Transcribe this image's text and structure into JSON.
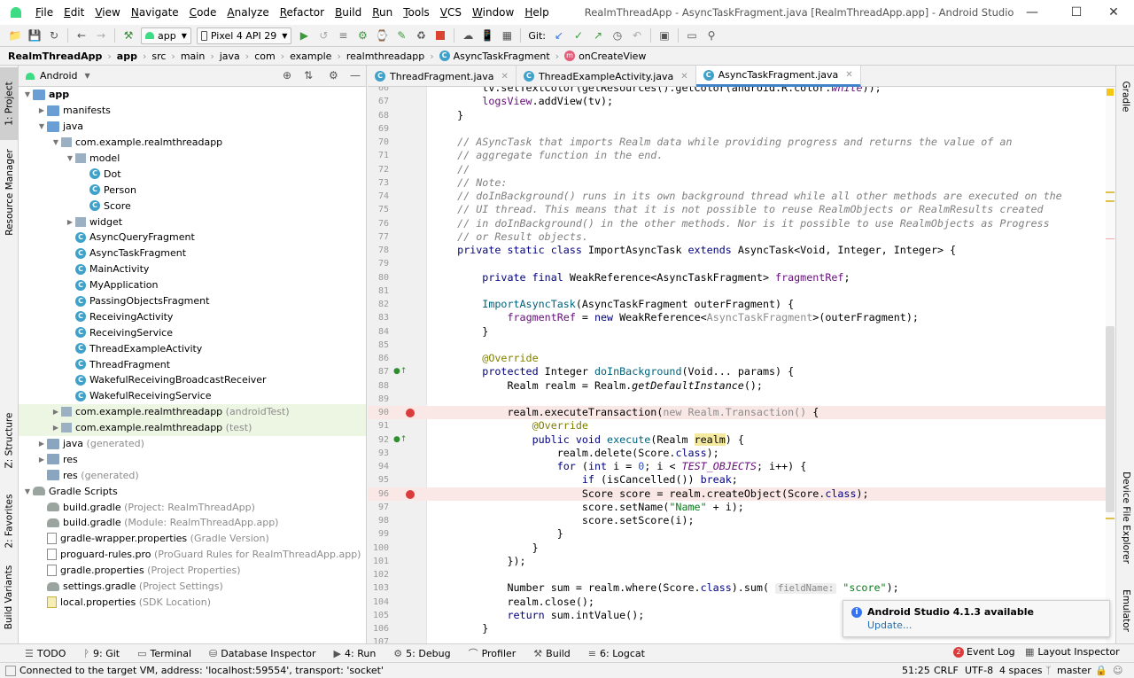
{
  "window": {
    "title": "RealmThreadApp - AsyncTaskFragment.java [RealmThreadApp.app] - Android Studio",
    "minimize_icon": "minimize-icon",
    "maximize_icon": "maximize-icon",
    "close_icon": "close-icon"
  },
  "menu": [
    "File",
    "Edit",
    "View",
    "Navigate",
    "Code",
    "Analyze",
    "Refactor",
    "Build",
    "Run",
    "Tools",
    "VCS",
    "Window",
    "Help"
  ],
  "toolbar": {
    "run_config": "app",
    "device": "Pixel 4 API 29",
    "git_label": "Git:"
  },
  "breadcrumb": [
    "RealmThreadApp",
    "app",
    "src",
    "main",
    "java",
    "com",
    "example",
    "realmthreadapp",
    "AsyncTaskFragment",
    "onCreateView"
  ],
  "project_panel": {
    "view_mode": "Android",
    "tree": [
      {
        "label": "app",
        "extra": "",
        "depth": 0,
        "kind": "folder-blue",
        "open": true,
        "bold": true
      },
      {
        "label": "manifests",
        "extra": "",
        "depth": 1,
        "kind": "folder-blue",
        "open": false
      },
      {
        "label": "java",
        "extra": "",
        "depth": 1,
        "kind": "folder-blue",
        "open": true
      },
      {
        "label": "com.example.realmthreadapp",
        "extra": "",
        "depth": 2,
        "kind": "pkg",
        "open": true
      },
      {
        "label": "model",
        "extra": "",
        "depth": 3,
        "kind": "pkg",
        "open": true
      },
      {
        "label": "Dot",
        "extra": "",
        "depth": 4,
        "kind": "class"
      },
      {
        "label": "Person",
        "extra": "",
        "depth": 4,
        "kind": "class"
      },
      {
        "label": "Score",
        "extra": "",
        "depth": 4,
        "kind": "class"
      },
      {
        "label": "widget",
        "extra": "",
        "depth": 3,
        "kind": "pkg",
        "open": false
      },
      {
        "label": "AsyncQueryFragment",
        "extra": "",
        "depth": 3,
        "kind": "class"
      },
      {
        "label": "AsyncTaskFragment",
        "extra": "",
        "depth": 3,
        "kind": "class"
      },
      {
        "label": "MainActivity",
        "extra": "",
        "depth": 3,
        "kind": "class"
      },
      {
        "label": "MyApplication",
        "extra": "",
        "depth": 3,
        "kind": "class"
      },
      {
        "label": "PassingObjectsFragment",
        "extra": "",
        "depth": 3,
        "kind": "class"
      },
      {
        "label": "ReceivingActivity",
        "extra": "",
        "depth": 3,
        "kind": "class"
      },
      {
        "label": "ReceivingService",
        "extra": "",
        "depth": 3,
        "kind": "class"
      },
      {
        "label": "ThreadExampleActivity",
        "extra": "",
        "depth": 3,
        "kind": "class"
      },
      {
        "label": "ThreadFragment",
        "extra": "",
        "depth": 3,
        "kind": "class"
      },
      {
        "label": "WakefulReceivingBroadcastReceiver",
        "extra": "",
        "depth": 3,
        "kind": "class"
      },
      {
        "label": "WakefulReceivingService",
        "extra": "",
        "depth": 3,
        "kind": "class"
      },
      {
        "label": "com.example.realmthreadapp",
        "extra": " (androidTest)",
        "depth": 2,
        "kind": "pkg",
        "open": false,
        "hl": true
      },
      {
        "label": "com.example.realmthreadapp",
        "extra": " (test)",
        "depth": 2,
        "kind": "pkg",
        "open": false,
        "hl": true
      },
      {
        "label": "java",
        "extra": " (generated)",
        "depth": 1,
        "kind": "folder-src",
        "open": false
      },
      {
        "label": "res",
        "extra": "",
        "depth": 1,
        "kind": "folder-src",
        "open": false
      },
      {
        "label": "res",
        "extra": " (generated)",
        "depth": 1,
        "kind": "folder-src",
        "noarrow": true
      },
      {
        "label": "Gradle Scripts",
        "extra": "",
        "depth": 0,
        "kind": "grad",
        "open": true
      },
      {
        "label": "build.gradle",
        "extra": " (Project: RealmThreadApp)",
        "depth": 1,
        "kind": "grad"
      },
      {
        "label": "build.gradle",
        "extra": " (Module: RealmThreadApp.app)",
        "depth": 1,
        "kind": "grad"
      },
      {
        "label": "gradle-wrapper.properties",
        "extra": " (Gradle Version)",
        "depth": 1,
        "kind": "prop"
      },
      {
        "label": "proguard-rules.pro",
        "extra": " (ProGuard Rules for RealmThreadApp.app)",
        "depth": 1,
        "kind": "prop"
      },
      {
        "label": "gradle.properties",
        "extra": " (Project Properties)",
        "depth": 1,
        "kind": "prop"
      },
      {
        "label": "settings.gradle",
        "extra": " (Project Settings)",
        "depth": 1,
        "kind": "grad"
      },
      {
        "label": "local.properties",
        "extra": " (SDK Location)",
        "depth": 1,
        "kind": "prop-yellow"
      }
    ]
  },
  "left_stripe": [
    "1: Project",
    "Resource Manager",
    "Z: Structure",
    "2: Favorites",
    "Build Variants"
  ],
  "right_stripe": [
    "Gradle",
    "Device File Explorer",
    "Emulator"
  ],
  "tabs": [
    {
      "label": "ThreadFragment.java",
      "active": false
    },
    {
      "label": "ThreadExampleActivity.java",
      "active": false
    },
    {
      "label": "AsyncTaskFragment.java",
      "active": true
    }
  ],
  "editor": {
    "lines": [
      {
        "n": "66",
        "html": "        tv.setTextColor(getResources().getColor(android.R.color.<span class=\"fld itl\">white</span>));"
      },
      {
        "n": "67",
        "html": "        <span class=\"fld\">logsView</span>.addView(tv);"
      },
      {
        "n": "68",
        "html": "    }"
      },
      {
        "n": "69",
        "html": ""
      },
      {
        "n": "70",
        "html": "    <span class=\"cm\">// ASyncTask that imports Realm data while providing progress and returns the value of an</span>"
      },
      {
        "n": "71",
        "html": "    <span class=\"cm\">// aggregate function in the end.</span>"
      },
      {
        "n": "72",
        "html": "    <span class=\"cm\">//</span>"
      },
      {
        "n": "73",
        "html": "    <span class=\"cm\">// Note:</span>"
      },
      {
        "n": "74",
        "html": "    <span class=\"cm\">// doInBackground() runs in its own background thread while all other methods are executed on the</span>"
      },
      {
        "n": "75",
        "html": "    <span class=\"cm\">// UI thread. This means that it is not possible to reuse RealmObjects or RealmResults created</span>"
      },
      {
        "n": "76",
        "html": "    <span class=\"cm\">// in doInBackground() in the other methods. Nor is it possible to use RealmObjects as Progress</span>"
      },
      {
        "n": "77",
        "html": "    <span class=\"cm\">// or Result objects.</span>"
      },
      {
        "n": "78",
        "html": "    <span class=\"kw\">private static class</span> ImportAsyncTask <span class=\"kw\">extends</span> AsyncTask&lt;Void, Integer, Integer&gt; {"
      },
      {
        "n": "79",
        "html": ""
      },
      {
        "n": "80",
        "html": "        <span class=\"kw\">private final</span> WeakReference&lt;AsyncTaskFragment&gt; <span class=\"fld\">fragmentRef</span>;"
      },
      {
        "n": "81",
        "html": ""
      },
      {
        "n": "82",
        "html": "        <span class=\"mt\">ImportAsyncTask</span>(AsyncTaskFragment outerFragment) {"
      },
      {
        "n": "83",
        "html": "            <span class=\"fld\">fragmentRef</span> = <span class=\"kw\">new</span> WeakReference&lt;<span class=\"gr\">AsyncTaskFragment</span>&gt;(outerFragment);"
      },
      {
        "n": "84",
        "html": "        }"
      },
      {
        "n": "85",
        "html": ""
      },
      {
        "n": "86",
        "html": "        <span class=\"an\">@Override</span>"
      },
      {
        "n": "87",
        "html": "        <span class=\"kw\">protected</span> Integer <span class=\"mt\">doInBackground</span>(Void... params) {",
        "ov": true
      },
      {
        "n": "88",
        "html": "            Realm realm = Realm.<span class=\"itl\">getDefaultInstance</span>();"
      },
      {
        "n": "89",
        "html": ""
      },
      {
        "n": "90",
        "html": "            realm.executeTransaction(<span class=\"gr\">new Realm.Transaction()</span> {",
        "bp": true
      },
      {
        "n": "91",
        "html": "                <span class=\"an\">@Override</span>"
      },
      {
        "n": "92",
        "html": "                <span class=\"kw\">public void</span> <span class=\"mt\">execute</span>(Realm <span style=\"background:#f5eaa0\">realm</span>) {",
        "ov": true
      },
      {
        "n": "93",
        "html": "                    realm.delete(Score.<span class=\"kw\">class</span>);"
      },
      {
        "n": "94",
        "html": "                    <span class=\"kw\">for</span> (<span class=\"kw\">int</span> i = <span style=\"color:#1750eb\">0</span>; i &lt; <span class=\"fld itl\">TEST_OBJECTS</span>; i++) {"
      },
      {
        "n": "95",
        "html": "                        <span class=\"kw\">if</span> (isCancelled()) <span class=\"kw\">break</span>;"
      },
      {
        "n": "96",
        "html": "                        Score score = realm.createObject(Score.<span class=\"kw\">class</span>);",
        "bp": true
      },
      {
        "n": "97",
        "html": "                        score.setName(<span class=\"st\">\"Name\"</span> + i);"
      },
      {
        "n": "98",
        "html": "                        score.setScore(i);"
      },
      {
        "n": "99",
        "html": "                    }"
      },
      {
        "n": "100",
        "html": "                }"
      },
      {
        "n": "101",
        "html": "            });"
      },
      {
        "n": "102",
        "html": ""
      },
      {
        "n": "103",
        "html": "            Number sum = realm.where(Score.<span class=\"kw\">class</span>).sum( <span class=\"hint\">fieldName:</span> <span class=\"st\">\"score\"</span>);"
      },
      {
        "n": "104",
        "html": "            realm.close();"
      },
      {
        "n": "105",
        "html": "            <span class=\"kw\">return</span> sum.intValue();"
      },
      {
        "n": "106",
        "html": "        }"
      },
      {
        "n": "107",
        "html": ""
      }
    ]
  },
  "notification": {
    "title": "Android Studio 4.1.3 available",
    "link": "Update..."
  },
  "bottom_tools": [
    {
      "icon": "todo-icon",
      "label": "TODO"
    },
    {
      "icon": "git-icon",
      "label": "9: Git"
    },
    {
      "icon": "terminal-icon",
      "label": "Terminal"
    },
    {
      "icon": "database-icon",
      "label": "Database Inspector"
    },
    {
      "icon": "run-icon",
      "label": "4: Run"
    },
    {
      "icon": "debug-icon",
      "label": "5: Debug"
    },
    {
      "icon": "profiler-icon",
      "label": "Profiler"
    },
    {
      "icon": "build-icon",
      "label": "Build"
    },
    {
      "icon": "logcat-icon",
      "label": "6: Logcat"
    }
  ],
  "bottom_right_tools": {
    "event_log_count": "2",
    "event_log": "Event Log",
    "layout_inspector": "Layout Inspector"
  },
  "status": {
    "message": "Connected to the target VM, address: 'localhost:59554', transport: 'socket'",
    "position": "51:25",
    "line_sep": "CRLF",
    "encoding": "UTF-8",
    "indent": "4 spaces",
    "branch": "master"
  },
  "colors": {
    "accent": "#4083c9",
    "breakpoint": "#db3b3b",
    "keyword": "#000080",
    "comment": "#808080"
  }
}
